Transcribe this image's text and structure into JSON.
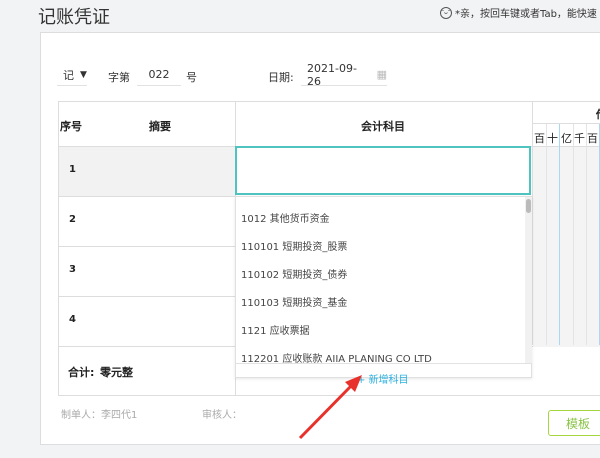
{
  "title": "记账凭证",
  "tip": "*亲，按回车键或者Tab，能快速",
  "form": {
    "type": "记",
    "zi_label": "字第",
    "number": "022",
    "hao": "号",
    "date_label": "日期:",
    "date": "2021-09-26"
  },
  "table": {
    "col_index": "序号",
    "col_summary": "摘要",
    "col_account": "会计科目",
    "col_debit": "借",
    "digits": [
      "百",
      "十",
      "亿",
      "千",
      "百"
    ],
    "rows": [
      "1",
      "2",
      "3",
      "4"
    ],
    "total_label": "合计:",
    "total_value": "零元整"
  },
  "dropdown": {
    "items": [
      "1012 其他货币资金",
      "110101 短期投资_股票",
      "110102 短期投资_债券",
      "110103 短期投资_基金",
      "1121 应收票据",
      "112201 应收账款 AIIA PLANING CO LTD"
    ],
    "add": "+ 新增科目"
  },
  "footer": {
    "maker": "制单人：李四代1",
    "reviewer": "审核人：",
    "template_btn": "模板"
  },
  "colors": {
    "accent": "#4ec3c0",
    "link": "#2bb3e0",
    "green": "#a5d63f",
    "arrow": "#e8312a"
  }
}
